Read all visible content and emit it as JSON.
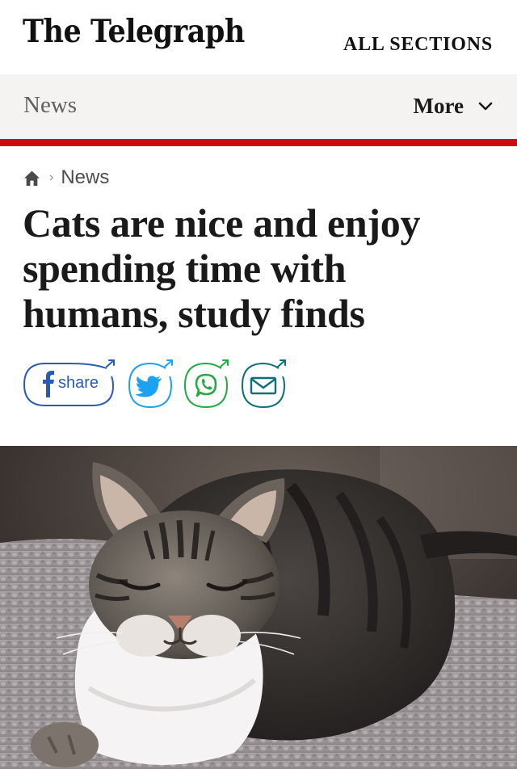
{
  "masthead": {
    "logo_text": "The Telegraph",
    "all_sections_label": "ALL SECTIONS"
  },
  "section_bar": {
    "section_label": "News",
    "more_label": "More"
  },
  "breadcrumb": {
    "items": [
      "News"
    ]
  },
  "article": {
    "headline": "Cats are nice and enjoy spending time with humans, study finds"
  },
  "share": {
    "facebook_label": "share",
    "icons": [
      "facebook-icon",
      "twitter-icon",
      "whatsapp-icon",
      "email-icon"
    ]
  },
  "hero_image": {
    "subject": "tabby cat with white chest resting on a knitted blanket"
  },
  "colors": {
    "brand_red": "#cc0a13",
    "section_bar_bg": "#f5f3f1",
    "facebook_blue": "#2a5bb3",
    "twitter_blue": "#1da1f2",
    "whatsapp_green": "#25a945",
    "email_teal": "#0e6e7a"
  }
}
